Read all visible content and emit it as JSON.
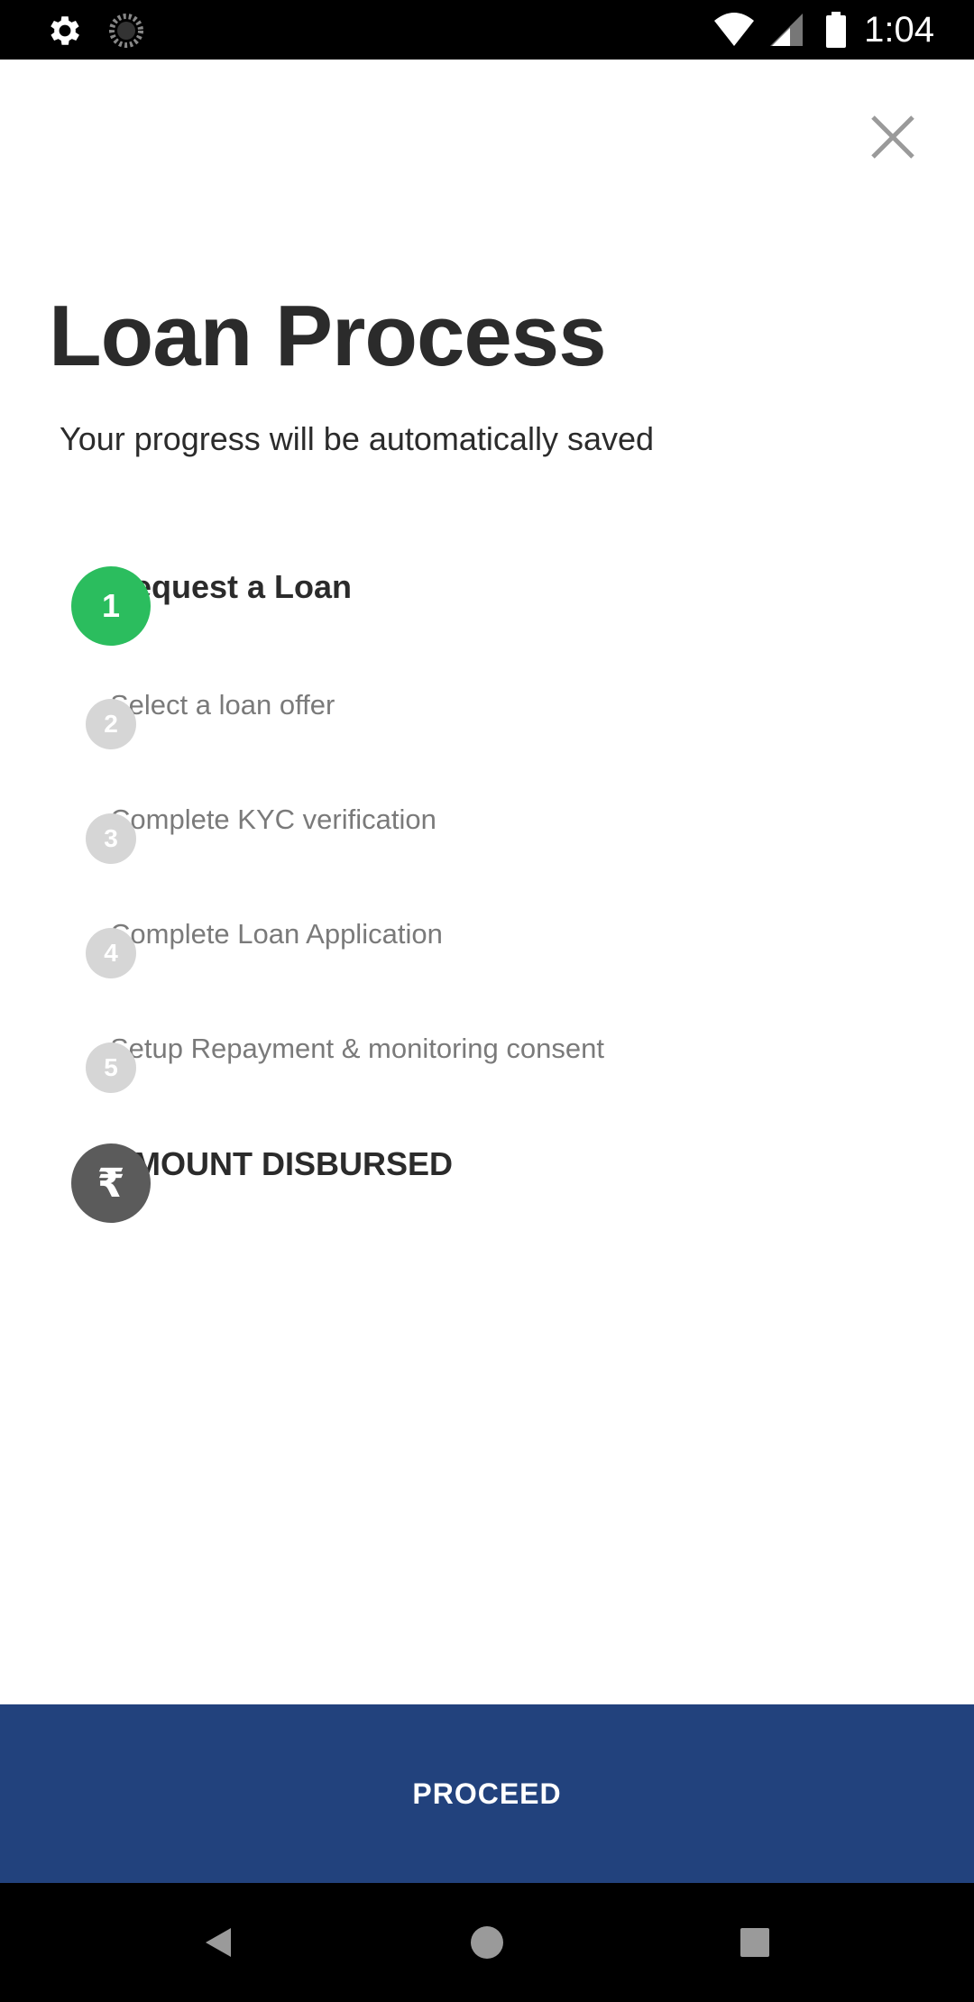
{
  "status_bar": {
    "time": "1:04",
    "icons": [
      "settings-icon",
      "loading-icon",
      "wifi-icon",
      "signal-icon",
      "battery-icon"
    ]
  },
  "header": {
    "close_icon": "close-icon"
  },
  "main": {
    "title": "Loan Process",
    "subtitle": "Your progress will be automatically saved",
    "steps": [
      {
        "number": "1",
        "label": "Request a Loan",
        "state": "active",
        "color": "#2bbd5e"
      },
      {
        "number": "2",
        "label": "Select a loan offer",
        "state": "pending"
      },
      {
        "number": "3",
        "label": "Complete KYC verification",
        "state": "pending"
      },
      {
        "number": "4",
        "label": "Complete Loan Application",
        "state": "pending"
      },
      {
        "number": "5",
        "label": "Setup Repayment & monitoring consent",
        "state": "pending"
      },
      {
        "number": "₹",
        "label": "AMOUNT DISBURSED",
        "state": "final"
      }
    ]
  },
  "footer": {
    "proceed_label": "PROCEED",
    "color": "#22427d"
  },
  "nav_bar": {
    "icons": [
      "back-icon",
      "home-icon",
      "recents-icon"
    ]
  }
}
